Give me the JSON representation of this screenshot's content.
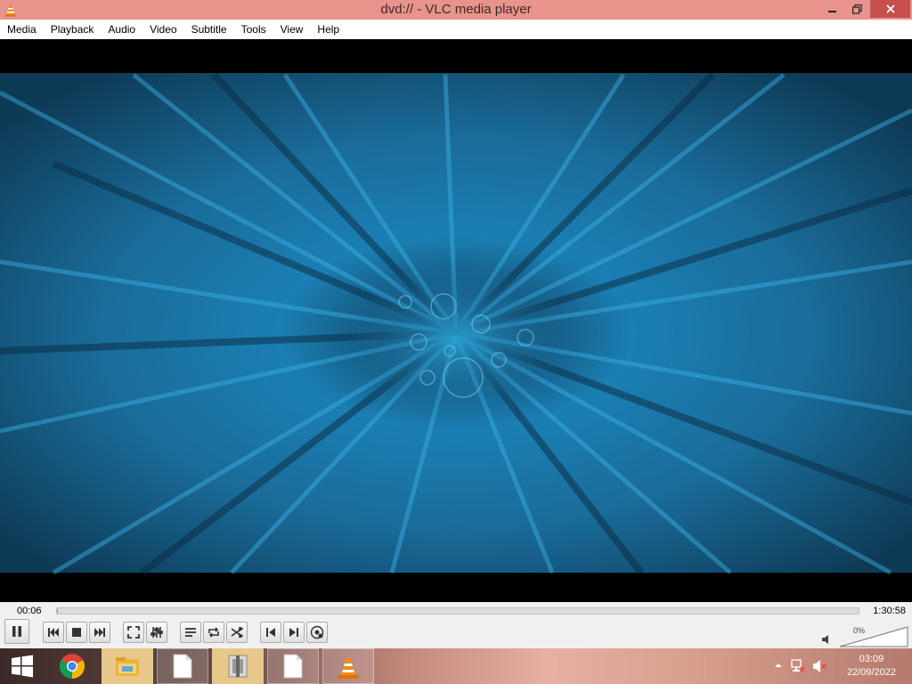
{
  "window": {
    "title": "dvd:// - VLC media player"
  },
  "menu": [
    "Media",
    "Playback",
    "Audio",
    "Video",
    "Subtitle",
    "Tools",
    "View",
    "Help"
  ],
  "player": {
    "elapsed": "00:06",
    "total": "1:30:58",
    "progress_fraction": 0.001,
    "volume": "0%",
    "volume_fraction": 0.0
  },
  "controls": [
    "pause-icon",
    "previous-icon",
    "stop-icon",
    "next-icon",
    "fullscreen-icon",
    "extended-settings-icon",
    "playlist-icon",
    "loop-icon",
    "shuffle-icon",
    "previous-frame-icon",
    "next-frame-icon",
    "snapshot-icon"
  ],
  "taskbar": {
    "items": [
      "windows-start-icon",
      "chrome-icon",
      "file-explorer-icon",
      "document-icon",
      "archive-icon",
      "document-icon",
      "vlc-icon"
    ],
    "clock": {
      "time": "03:09",
      "date": "22/09/2022"
    }
  },
  "colors": {
    "titlebar": "#e8938c",
    "close": "#c7504a",
    "video_blue": "#1a8fc7"
  }
}
